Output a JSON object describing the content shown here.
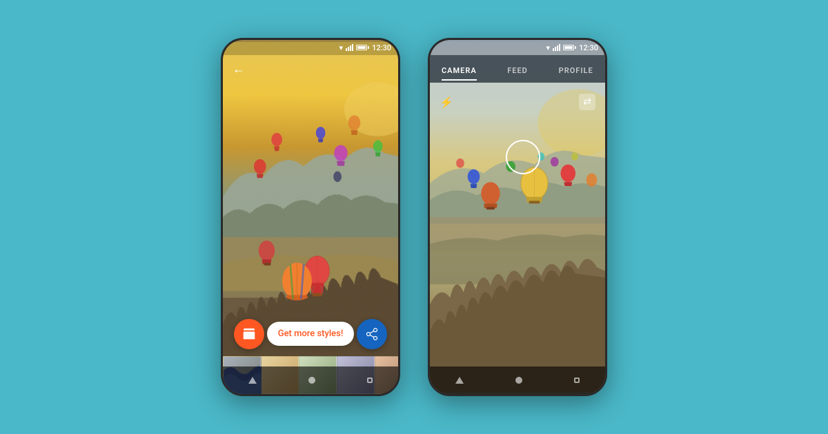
{
  "background_color": "#4ab8c8",
  "left_phone": {
    "status_bar": {
      "time": "12:30"
    },
    "back_button": "←",
    "action_bar": {
      "get_more_label": "Get more styles!",
      "store_icon": "🏪",
      "share_icon": "⋮"
    },
    "scene": "artistic-hot-air-balloons-cappadocia"
  },
  "right_phone": {
    "status_bar": {
      "time": "12:30"
    },
    "tabs": [
      {
        "label": "CAMERA",
        "active": true
      },
      {
        "label": "FEED",
        "active": false
      },
      {
        "label": "PROFILE",
        "active": false
      }
    ],
    "camera_tab": "CAMERA",
    "feed_tab": "FEED",
    "profile_tab": "PROFILE",
    "flash_icon": "⚡",
    "flip_icon": "⇄",
    "scene": "photo-hot-air-balloons-cappadocia"
  }
}
